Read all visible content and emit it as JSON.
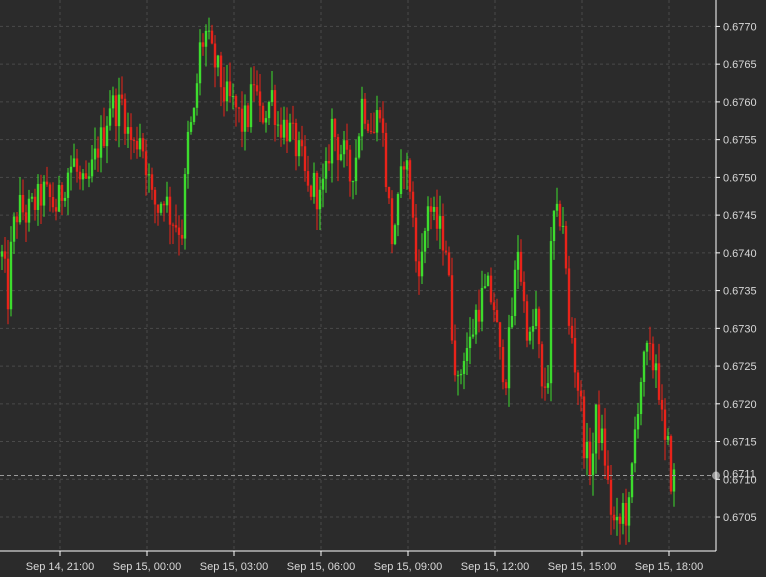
{
  "chart_data": {
    "type": "candlestick",
    "title": "",
    "xlabel": "",
    "ylabel": "",
    "ylim": [
      0.67005,
      0.67735
    ],
    "y_ticks": [
      "0.6705",
      "0.6710",
      "0.6715",
      "0.6720",
      "0.6725",
      "0.6730",
      "0.6735",
      "0.6740",
      "0.6745",
      "0.6750",
      "0.6755",
      "0.6760",
      "0.6765",
      "0.6770"
    ],
    "x_ticks": [
      "Sep 14, 21:00",
      "Sep 15, 00:00",
      "Sep 15, 03:00",
      "Sep 15, 06:00",
      "Sep 15, 09:00",
      "Sep 15, 12:00",
      "Sep 15, 15:00",
      "Sep 15, 18:00"
    ],
    "grid": true,
    "current_price_label": "0.6711",
    "current_price": 0.67105,
    "colors": {
      "background": "#2b2b2b",
      "grid": "#4a4a4a",
      "up": "#3ddc2e",
      "down": "#e8231a",
      "axis": "#ffffff",
      "text": "#d8d8d8",
      "price_line": "#9a9a9a"
    },
    "keypoints": [
      [
        0,
        0.6741
      ],
      [
        4,
        0.6738
      ],
      [
        8,
        0.6734
      ],
      [
        12,
        0.6742
      ],
      [
        16,
        0.6745
      ],
      [
        20,
        0.6746
      ],
      [
        26,
        0.6745
      ],
      [
        32,
        0.6746
      ],
      [
        38,
        0.6747
      ],
      [
        44,
        0.6748
      ],
      [
        50,
        0.6747
      ],
      [
        56,
        0.6746
      ],
      [
        62,
        0.6748
      ],
      [
        68,
        0.6751
      ],
      [
        74,
        0.6752
      ],
      [
        80,
        0.6749
      ],
      [
        86,
        0.6748
      ],
      [
        92,
        0.6751
      ],
      [
        98,
        0.6754
      ],
      [
        104,
        0.6756
      ],
      [
        110,
        0.676
      ],
      [
        116,
        0.6759
      ],
      [
        122,
        0.676
      ],
      [
        128,
        0.6756
      ],
      [
        134,
        0.6754
      ],
      [
        140,
        0.6756
      ],
      [
        146,
        0.6752
      ],
      [
        152,
        0.6747
      ],
      [
        158,
        0.6746
      ],
      [
        164,
        0.6748
      ],
      [
        170,
        0.6745
      ],
      [
        176,
        0.6744
      ],
      [
        182,
        0.6743
      ],
      [
        188,
        0.6755
      ],
      [
        194,
        0.6758
      ],
      [
        200,
        0.6767
      ],
      [
        206,
        0.6769
      ],
      [
        212,
        0.6766
      ],
      [
        218,
        0.6764
      ],
      [
        224,
        0.6761
      ],
      [
        230,
        0.676
      ],
      [
        236,
        0.6759
      ],
      [
        242,
        0.6757
      ],
      [
        248,
        0.6758
      ],
      [
        254,
        0.6763
      ],
      [
        260,
        0.6758
      ],
      [
        266,
        0.6759
      ],
      [
        272,
        0.6761
      ],
      [
        278,
        0.6757
      ],
      [
        284,
        0.6757
      ],
      [
        290,
        0.6756
      ],
      [
        296,
        0.6754
      ],
      [
        302,
        0.6752
      ],
      [
        308,
        0.6748
      ],
      [
        314,
        0.6749
      ],
      [
        320,
        0.6747
      ],
      [
        326,
        0.675
      ],
      [
        332,
        0.6757
      ],
      [
        338,
        0.6754
      ],
      [
        344,
        0.6753
      ],
      [
        350,
        0.675
      ],
      [
        356,
        0.6753
      ],
      [
        362,
        0.676
      ],
      [
        368,
        0.6758
      ],
      [
        374,
        0.6756
      ],
      [
        380,
        0.676
      ],
      [
        386,
        0.675
      ],
      [
        392,
        0.6742
      ],
      [
        398,
        0.6746
      ],
      [
        404,
        0.6753
      ],
      [
        410,
        0.6749
      ],
      [
        416,
        0.6739
      ],
      [
        422,
        0.6739
      ],
      [
        428,
        0.6747
      ],
      [
        434,
        0.6744
      ],
      [
        440,
        0.6743
      ],
      [
        446,
        0.6741
      ],
      [
        452,
        0.673
      ],
      [
        458,
        0.6722
      ],
      [
        464,
        0.6727
      ],
      [
        470,
        0.6728
      ],
      [
        476,
        0.6732
      ],
      [
        482,
        0.6734
      ],
      [
        488,
        0.6735
      ],
      [
        494,
        0.6733
      ],
      [
        500,
        0.6726
      ],
      [
        506,
        0.6724
      ],
      [
        512,
        0.6732
      ],
      [
        518,
        0.6741
      ],
      [
        524,
        0.6733
      ],
      [
        530,
        0.6728
      ],
      [
        536,
        0.6732
      ],
      [
        542,
        0.6721
      ],
      [
        548,
        0.6724
      ],
      [
        552,
        0.6745
      ],
      [
        556,
        0.6744
      ],
      [
        560,
        0.6745
      ],
      [
        564,
        0.6744
      ],
      [
        568,
        0.673
      ],
      [
        572,
        0.6729
      ],
      [
        576,
        0.6724
      ],
      [
        580,
        0.6721
      ],
      [
        584,
        0.6715
      ],
      [
        588,
        0.6712
      ],
      [
        592,
        0.6712
      ],
      [
        596,
        0.6718
      ],
      [
        600,
        0.6716
      ],
      [
        604,
        0.6714
      ],
      [
        608,
        0.6709
      ],
      [
        612,
        0.6705
      ],
      [
        616,
        0.6703
      ],
      [
        620,
        0.6704
      ],
      [
        624,
        0.6707
      ],
      [
        628,
        0.6704
      ],
      [
        632,
        0.6711
      ],
      [
        636,
        0.6718
      ],
      [
        640,
        0.6723
      ],
      [
        644,
        0.6725
      ],
      [
        648,
        0.6727
      ],
      [
        652,
        0.6725
      ],
      [
        656,
        0.6726
      ],
      [
        660,
        0.6721
      ],
      [
        664,
        0.6714
      ],
      [
        668,
        0.6714
      ],
      [
        672,
        0.6709
      ],
      [
        676,
        0.6711
      ]
    ]
  }
}
